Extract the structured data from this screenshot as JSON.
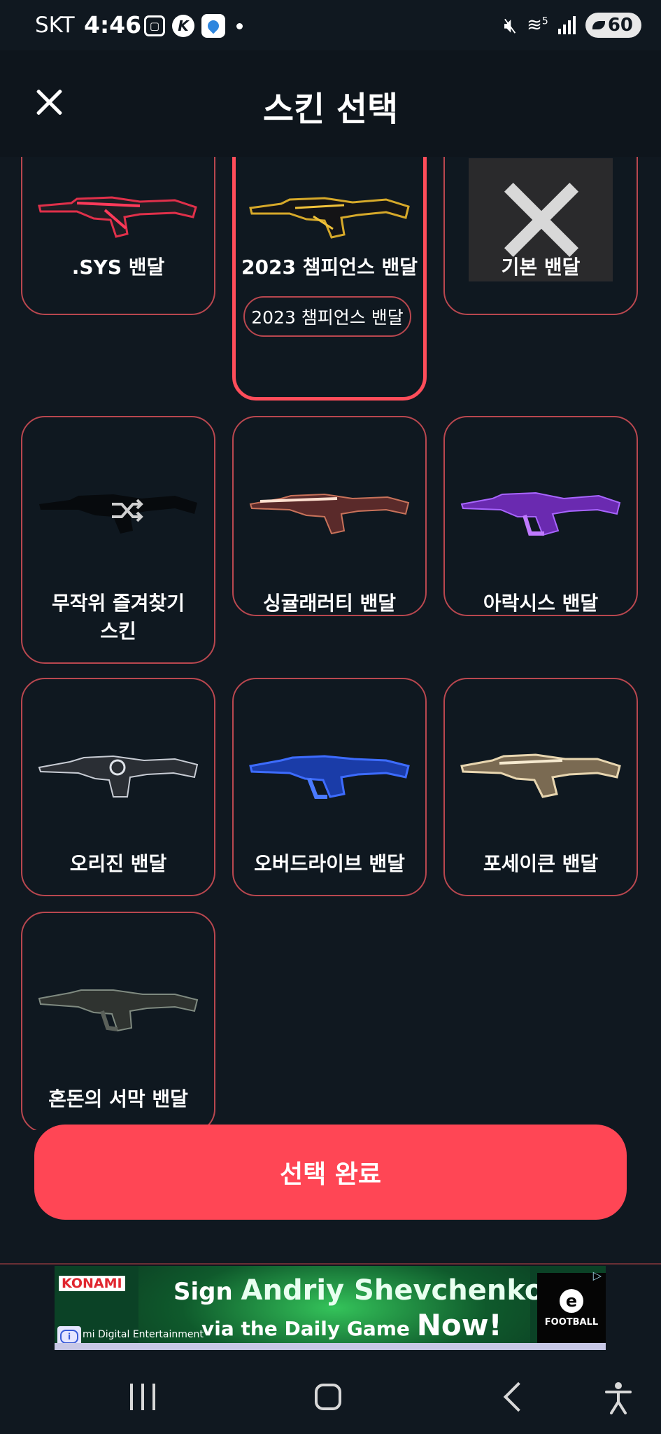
{
  "status_bar": {
    "carrier": "SKT",
    "time": "4:46",
    "battery": "60",
    "network": "5"
  },
  "header": {
    "title": "스킨 선택"
  },
  "skins": [
    {
      "name": ".SYS 밴달",
      "selected": false
    },
    {
      "name": "2023 챔피언스 밴달",
      "selected": true,
      "chip": "2023 챔피언스 밴달"
    },
    {
      "name": "기본 밴달",
      "selected": false
    },
    {
      "name": "무작위 즐겨찾기\n스킨",
      "selected": false
    },
    {
      "name": "싱귤래러티 밴달",
      "selected": false
    },
    {
      "name": "아락시스 밴달",
      "selected": false
    },
    {
      "name": "오리진 밴달",
      "selected": false
    },
    {
      "name": "오버드라이브 밴달",
      "selected": false
    },
    {
      "name": "포세이큰 밴달",
      "selected": false
    },
    {
      "name": "혼돈의 서막 밴달",
      "selected": false
    }
  ],
  "confirm_button": {
    "label": "선택 완료"
  },
  "ad": {
    "brand": "KONAMI",
    "line1_prefix": "Sign",
    "line1_name": "Andriy Shevchenko",
    "line2_prefix": "via the Daily Game",
    "line2_suffix": "Now!",
    "company": "mi Digital Entertainment",
    "product": "FOOTBALL",
    "product_logo": "e"
  },
  "colors": {
    "background": "#101820",
    "accent": "#ff4655",
    "card_border": "#b9474f"
  }
}
